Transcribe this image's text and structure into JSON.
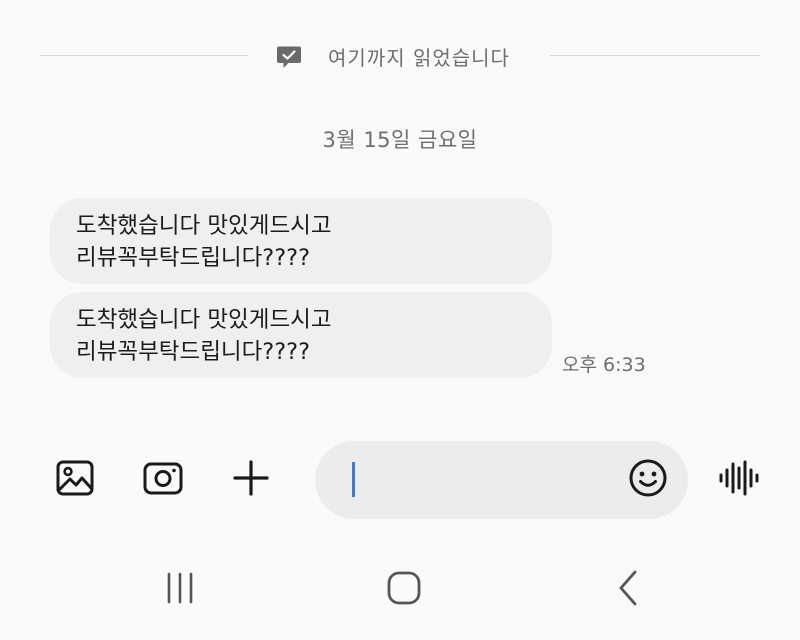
{
  "read_marker": {
    "icon": "chat-bubble-check-icon",
    "text": "여기까지 읽었습니다"
  },
  "date_header": "3월 15일 금요일",
  "messages": [
    {
      "lines": [
        "도착했습니다 맛있게드시고",
        "리뷰꼭부탁드립니다????"
      ]
    },
    {
      "lines": [
        "도착했습니다 맛있게드시고",
        "리뷰꼭부탁드립니다????"
      ],
      "time": "오후 6:33"
    }
  ],
  "composer": {
    "value": "",
    "placeholder": "",
    "left_icons": [
      "gallery-icon",
      "camera-icon",
      "plus-icon"
    ],
    "inner_icon": "emoji-icon",
    "right_icon": "voice-wave-icon"
  },
  "nav_bar": {
    "icons": [
      "recent-apps-icon",
      "home-icon",
      "back-icon"
    ]
  },
  "colors": {
    "background": "#fafafa",
    "bubble": "#efefef",
    "muted_text": "#6e6e6e",
    "caret": "#3a7be0"
  }
}
